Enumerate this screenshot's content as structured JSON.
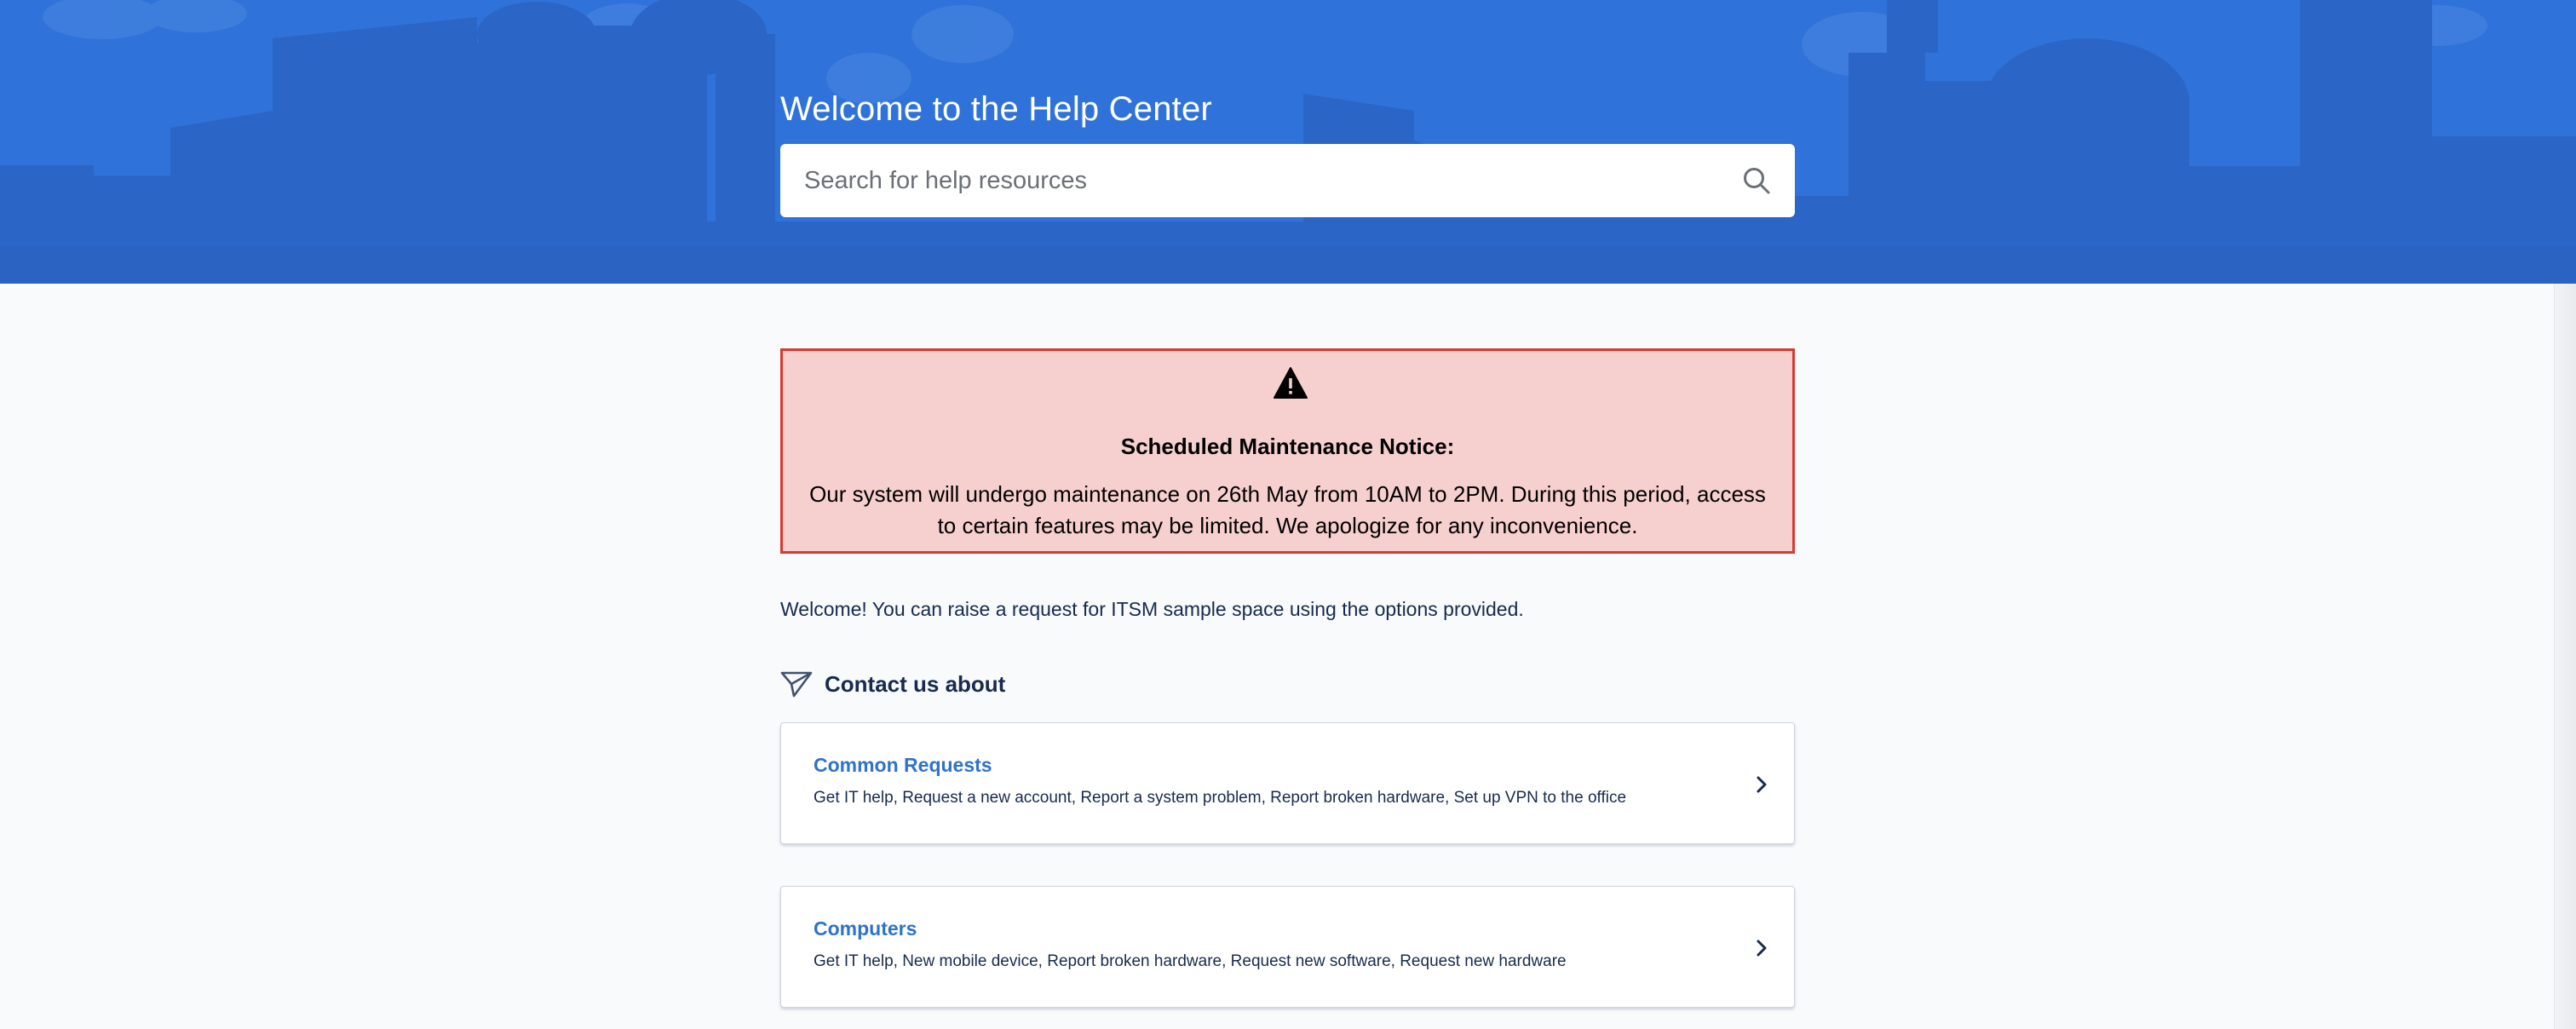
{
  "hero": {
    "title": "Welcome to the Help Center",
    "search_placeholder": "Search for help resources",
    "search_icon": "search-icon",
    "background_color": "#2f72d9"
  },
  "notice": {
    "icon": "warning-icon",
    "title": "Scheduled Maintenance Notice:",
    "body": "Our system will undergo maintenance on 26th May from 10AM to 2PM. During this period, access to certain features may be limited. We apologize for any inconvenience.",
    "background_color": "#f6cfcf",
    "border_color": "#d63a31"
  },
  "welcome_text": "Welcome! You can raise a request for ITSM sample space using the options provided.",
  "contact": {
    "icon": "send-icon",
    "title": "Contact us about"
  },
  "cards": [
    {
      "title": "Common Requests",
      "description": "Get IT help, Request a new account, Report a system problem, Report broken hardware, Set up VPN to the office",
      "icon": "chevron-right-icon"
    },
    {
      "title": "Computers",
      "description": "Get IT help, New mobile device, Report broken hardware, Request new software, Request new hardware",
      "icon": "chevron-right-icon"
    }
  ],
  "colors": {
    "link": "#2f72c9",
    "text": "#172b4d"
  }
}
